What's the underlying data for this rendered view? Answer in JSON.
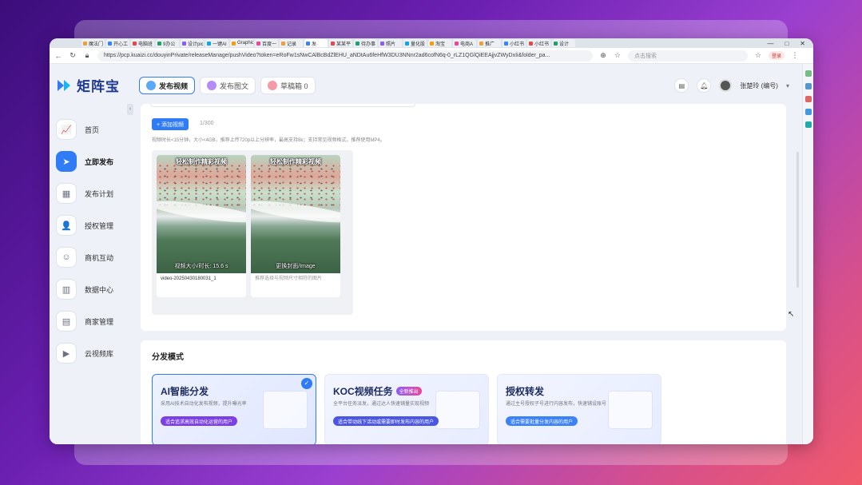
{
  "browser": {
    "tabs": [
      "魔法门",
      "开心工",
      "电脑班",
      "9办公",
      "设计pic",
      "一键AI",
      "Graphic",
      "百度一",
      "记录",
      "发·",
      "某某平",
      "待办事",
      "照片",
      "量化股",
      "淘宝",
      "电商A",
      "推广",
      "小红书",
      "小红书",
      "设计"
    ],
    "active_tab": 9,
    "url": "https://pcp.kuaizi.cc/douyinPrivate/releaseManage/pushVideo?token=eRoFw1sNwCAlBcBdZlEHU_aNDtAu6feHfW3DU3NNnr2ad6cofN6q-0_rLZ1QGlQiEEAjjvZWyDxIi&folder_pa...",
    "search_placeholder": "点击搜索",
    "login_label": "登录",
    "win_controls": [
      "—",
      "□",
      "✕"
    ]
  },
  "app": {
    "logo_text": "矩阵宝",
    "sidebar": [
      {
        "label": "首页",
        "icon": "chart-icon",
        "glyph": "📈"
      },
      {
        "label": "立即发布",
        "icon": "send-icon",
        "glyph": "➤",
        "active": true
      },
      {
        "label": "发布计划",
        "icon": "calendar-icon",
        "glyph": "▦"
      },
      {
        "label": "授权管理",
        "icon": "user-auth-icon",
        "glyph": "👤"
      },
      {
        "label": "商机互动",
        "icon": "chat-icon",
        "glyph": "☺"
      },
      {
        "label": "数据中心",
        "icon": "bar-chart-icon",
        "glyph": "▥"
      },
      {
        "label": "商家管理",
        "icon": "shop-icon",
        "glyph": "▤"
      },
      {
        "label": "云视频库",
        "icon": "video-library-icon",
        "glyph": "▶"
      }
    ],
    "top_tabs": [
      {
        "label": "发布视频",
        "active": true,
        "color": "#5aa9f6"
      },
      {
        "label": "发布图文",
        "active": false,
        "color": "#b58cf5"
      },
      {
        "label": "草稿箱 0",
        "active": false,
        "color": "#f59aa6"
      }
    ],
    "username": "张楚玲 (编号)",
    "caret": "▾"
  },
  "upload": {
    "add_button": "+ 添加视频",
    "counter": "1/300",
    "hint": "视频时长<15分钟，大小<4GB，推荐上传720p以上分辨率，最高支持8k；支持常见视频格式，推荐使用MP4。",
    "videos": [
      {
        "caption_top": "轻松制作精彩视频",
        "caption_bottom": "视频大小/时长: 15.6 s",
        "name": "video-20250430180031_1",
        "note": ""
      },
      {
        "caption_top": "轻松制作精彩视频",
        "caption_bottom": "更换封面/Image",
        "name": "",
        "note": "推荐选择与视频尺寸相符的图片"
      }
    ]
  },
  "distribution": {
    "title": "分发模式",
    "modes": [
      {
        "title": "AI智能分发",
        "badge": "",
        "desc": "采用AI技术自动化发布视频，提升曝光率",
        "pill": "适合追求高效自动化运营的用户",
        "pill_color": "#7b3fe4",
        "selected": true
      },
      {
        "title": "KOC视频任务",
        "badge": "全新推出",
        "desc": "全平台任务派发，通过达人快速铺量实现视频",
        "pill": "适合带动线下活动或需要即时发布内容的用户",
        "pill_color": "#4a56e2",
        "selected": false
      },
      {
        "title": "授权转发",
        "badge": "",
        "desc": "通过主号授权子号进行内容发布，快速铺设账号",
        "pill": "适合需要批量分发内容的用户",
        "pill_color": "#3b82f6",
        "selected": false
      }
    ],
    "check_glyph": "✓"
  }
}
